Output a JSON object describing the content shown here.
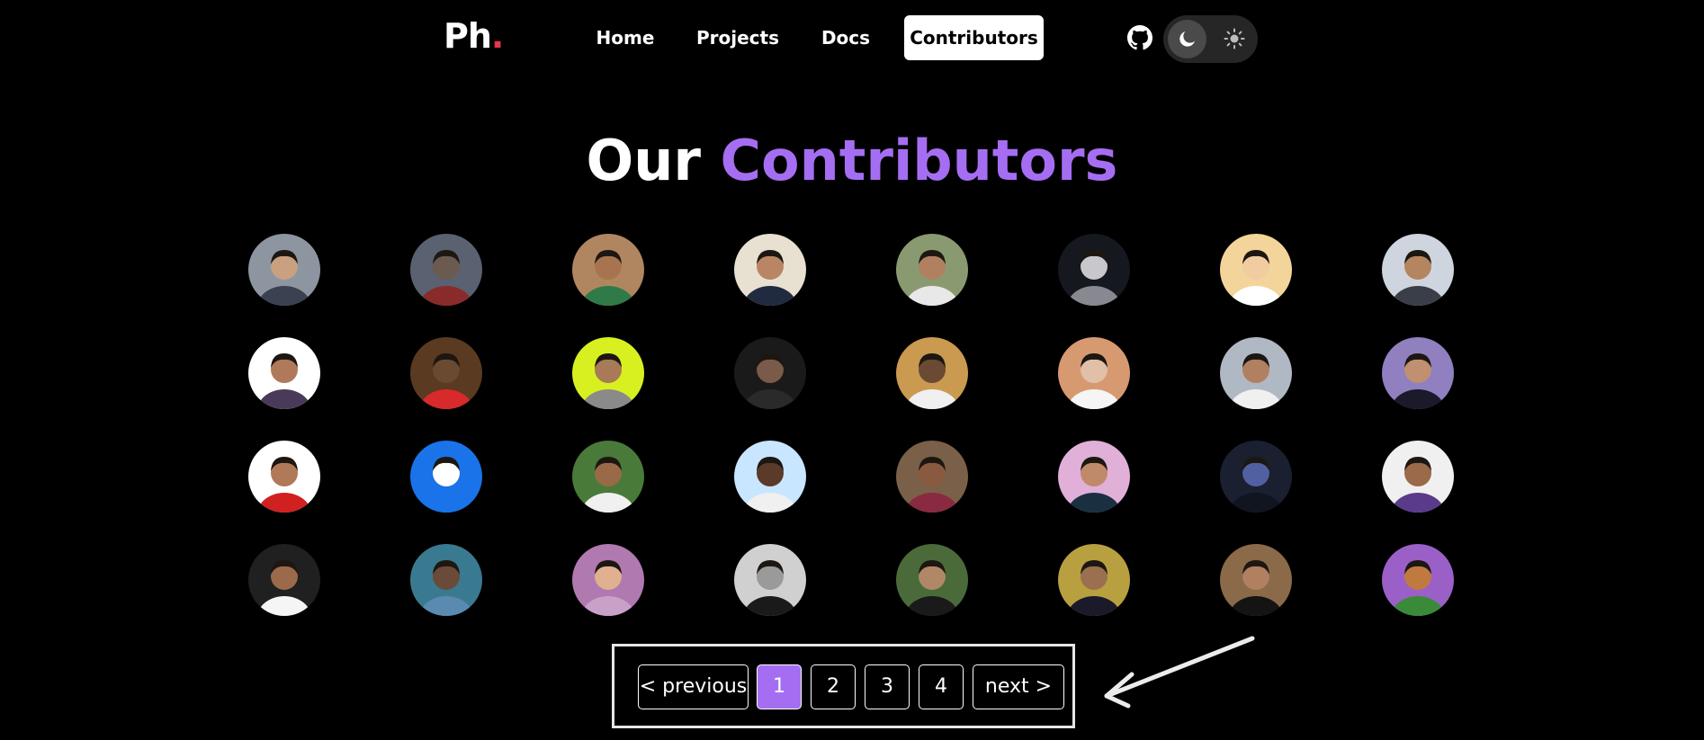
{
  "brand": {
    "logo_text": "Ph",
    "logo_dot": ".",
    "dot_color": "#e8344e"
  },
  "nav": {
    "home": "Home",
    "projects": "Projects",
    "docs": "Docs",
    "contributors": "Contributors",
    "active": "Contributors"
  },
  "header_icons": {
    "github": "github-icon",
    "theme_dark": "moon-icon",
    "theme_light": "sun-icon",
    "theme_mode": "dark"
  },
  "title": {
    "lead": "Our",
    "accent": "Contributors",
    "accent_color": "#a56ef2"
  },
  "avatars": [
    {
      "bg": "#8d96a0",
      "skin": "#c9a080",
      "shirt": "#3a4252"
    },
    {
      "bg": "#5a6170",
      "skin": "#6b5a50",
      "shirt": "#8a2b2b"
    },
    {
      "bg": "#b08660",
      "skin": "#a87450",
      "shirt": "#2f7a48"
    },
    {
      "bg": "#e8e0d0",
      "skin": "#b98565",
      "shirt": "#202a40"
    },
    {
      "bg": "#8a9a70",
      "skin": "#b08060",
      "shirt": "#e8e8e8"
    },
    {
      "bg": "#161820",
      "skin": "#c8c8cc",
      "shirt": "#888890"
    },
    {
      "bg": "#f3d49a",
      "skin": "#f0cca0",
      "shirt": "#ffffff"
    },
    {
      "bg": "#cfd5de",
      "skin": "#b58560",
      "shirt": "#3a3e48"
    },
    {
      "bg": "#ffffff",
      "skin": "#b07a5a",
      "shirt": "#4a3a5a"
    },
    {
      "bg": "#5a3a20",
      "skin": "#6a4a30",
      "shirt": "#d82a2a"
    },
    {
      "bg": "#d8f020",
      "skin": "#a87a58",
      "shirt": "#8a8a8a"
    },
    {
      "bg": "#1a1a1a",
      "skin": "#7a5a48",
      "shirt": "#2a2a2a"
    },
    {
      "bg": "#c99a50",
      "skin": "#6a4a32",
      "shirt": "#f0f0f0"
    },
    {
      "bg": "#d79a70",
      "skin": "#e0c0a8",
      "shirt": "#f5f5f5"
    },
    {
      "bg": "#b0b8c4",
      "skin": "#b08060",
      "shirt": "#f0f0f0"
    },
    {
      "bg": "#9080c0",
      "skin": "#c09070",
      "shirt": "#1a1a2a"
    },
    {
      "bg": "#ffffff",
      "skin": "#b07a58",
      "shirt": "#d02020"
    },
    {
      "bg": "#1a73e8",
      "skin": "#ffffff",
      "shirt": "#1a73e8"
    },
    {
      "bg": "#4a7a3a",
      "skin": "#9a6a48",
      "shirt": "#f0f0f0"
    },
    {
      "bg": "#c8e6ff",
      "skin": "#5a3a28",
      "shirt": "#f0f0f0"
    },
    {
      "bg": "#7a6048",
      "skin": "#8a5a40",
      "shirt": "#8a2a40"
    },
    {
      "bg": "#e0b0d8",
      "skin": "#c08a6a",
      "shirt": "#1a3040"
    },
    {
      "bg": "#1a2030",
      "skin": "#5060a0",
      "shirt": "#101520"
    },
    {
      "bg": "#f0f0f0",
      "skin": "#9a6a4a",
      "shirt": "#5a3a8a"
    },
    {
      "bg": "#202020",
      "skin": "#9a6a4a",
      "shirt": "#f5f5f5"
    },
    {
      "bg": "#3a7a90",
      "skin": "#6a4a38",
      "shirt": "#5a8ab0"
    },
    {
      "bg": "#b07ab0",
      "skin": "#e0b090",
      "shirt": "#c8a0c8"
    },
    {
      "bg": "#d0d0d0",
      "skin": "#9a9a9a",
      "shirt": "#1a1a1a"
    },
    {
      "bg": "#4a6a3a",
      "skin": "#b08868",
      "shirt": "#1a1a1a"
    },
    {
      "bg": "#b8a040",
      "skin": "#9a7050",
      "shirt": "#1a1a2a"
    },
    {
      "bg": "#8a6a48",
      "skin": "#b08060",
      "shirt": "#141414"
    },
    {
      "bg": "#9a60c8",
      "skin": "#c07a40",
      "shirt": "#3a8a3a"
    }
  ],
  "pagination": {
    "previous": "< previous",
    "pages": [
      "1",
      "2",
      "3",
      "4"
    ],
    "current": "1",
    "next": "next >",
    "active_color": "#a56ef2"
  }
}
